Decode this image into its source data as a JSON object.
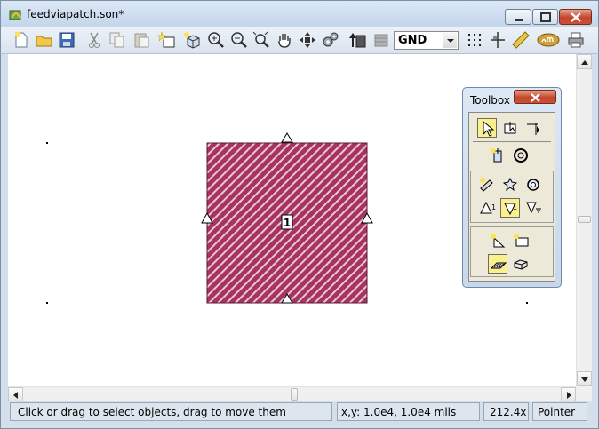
{
  "window": {
    "title": "feedviapatch.son*"
  },
  "toolbar": {
    "buttons": [
      "new-document-icon",
      "open-folder-icon",
      "save-icon",
      "cut-icon",
      "copy-icon",
      "paste-icon",
      "add-polygon-icon",
      "add-3d-icon",
      "zoom-in-icon",
      "zoom-out-icon",
      "zoom-fit-icon",
      "pan-hand-icon",
      "move-arrows-icon",
      "settings-gears-icon",
      "stack-up-icon",
      "stack-layers-icon",
      "grid-dots-icon",
      "align-icon",
      "ruler-icon",
      "em-icon",
      "print-icon"
    ],
    "layer_value": "GND"
  },
  "canvas": {
    "port_label": "1",
    "colors": {
      "metal_fill": "#a8335f",
      "hatch": "#e9c8d6"
    }
  },
  "toolbox": {
    "title": "Toolbox"
  },
  "status": {
    "message": "Click or drag to select objects, drag to move them",
    "coords": "x,y: 1.0e4, 1.0e4 mils",
    "zoom": "212.4x",
    "mode": "Pointer"
  }
}
